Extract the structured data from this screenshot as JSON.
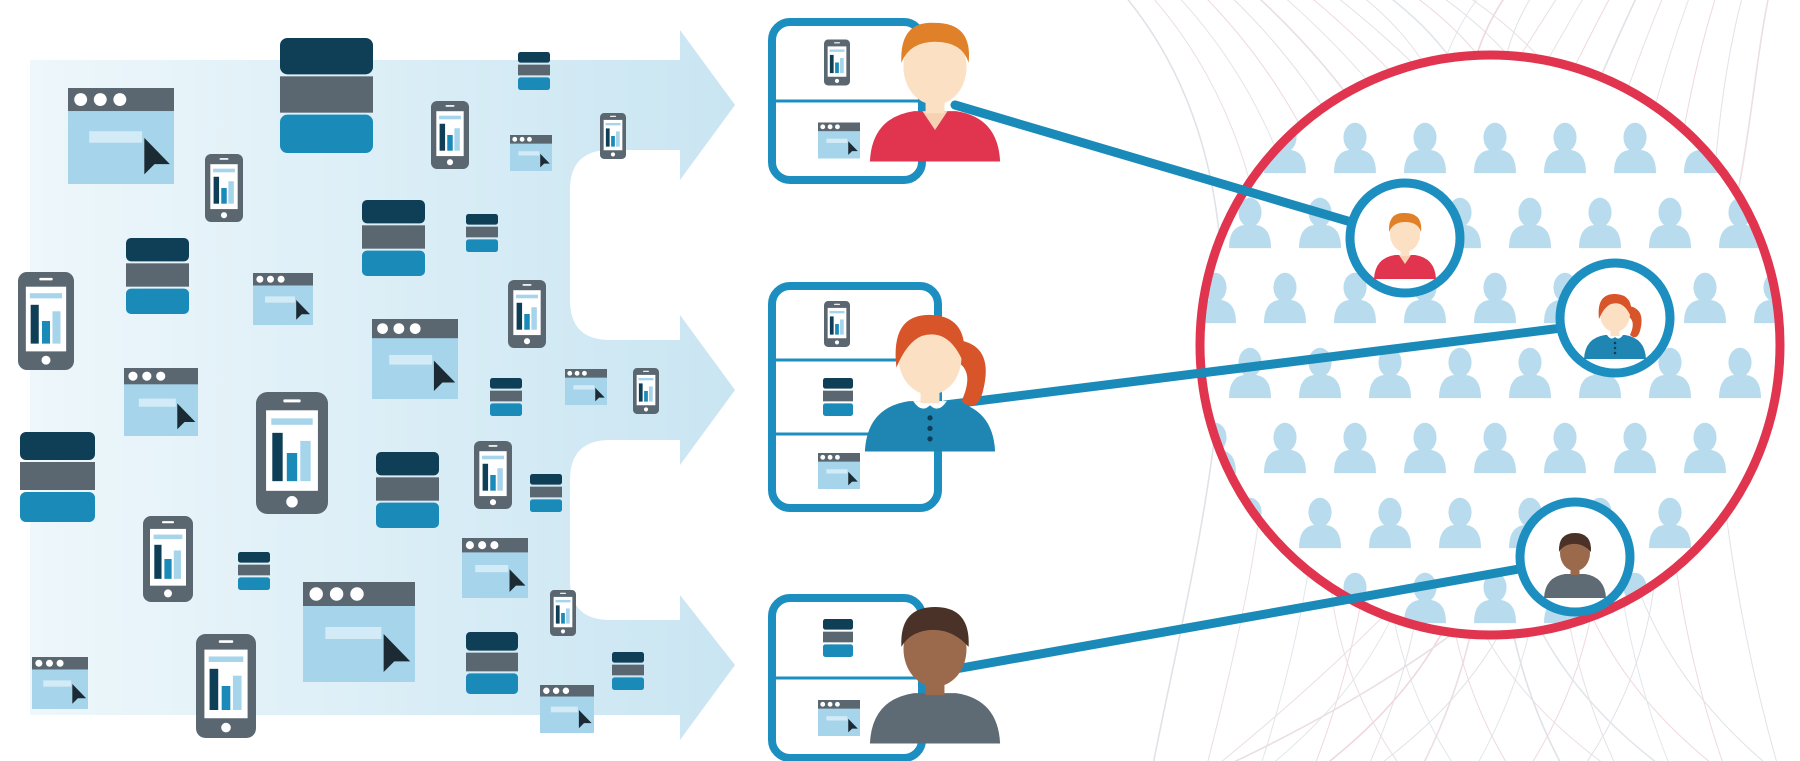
{
  "colors": {
    "dark": "#0f3e57",
    "gray": "#5a6770",
    "blue": "#1a8ab8",
    "light_blue": "#a6d4ea",
    "pale_blue": "#d7ecf6",
    "card_blue": "#1c8fc0",
    "red": "#e0344f",
    "crowd": "#b8dced",
    "skin_light": "#fce0c4",
    "hair_orange": "#e0812a",
    "hair_red": "#d8552a",
    "skin_dark": "#9b6a4c",
    "hair_dark": "#4a3228",
    "shirt_gray": "#5e6b74",
    "shirt_blue": "#1f86b3"
  },
  "icons": {
    "left_field": [
      "database-icon",
      "browser-window-icon",
      "mobile-chart-icon"
    ],
    "profiles": [
      {
        "person": "man-avatar",
        "devices": [
          "mobile-chart-icon",
          "browser-window-icon"
        ]
      },
      {
        "person": "woman-avatar",
        "devices": [
          "mobile-chart-icon",
          "database-icon",
          "browser-window-icon"
        ]
      },
      {
        "person": "dark-man-avatar",
        "devices": [
          "database-icon",
          "browser-window-icon"
        ]
      }
    ]
  }
}
